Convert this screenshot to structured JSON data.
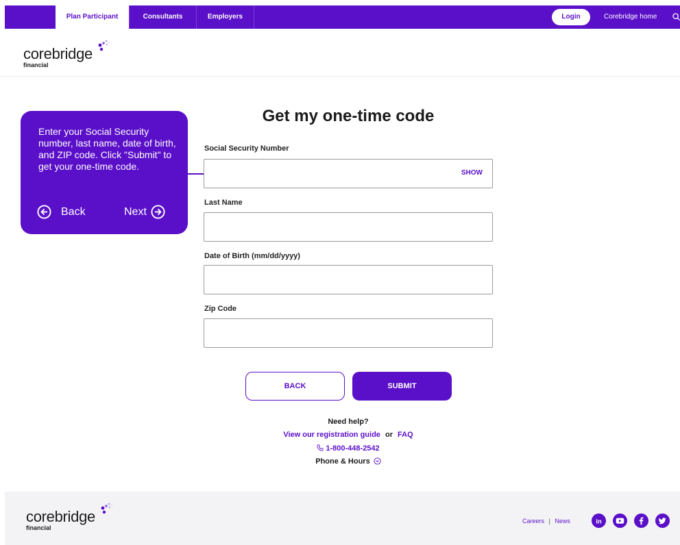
{
  "topnav": {
    "tabs": [
      "Plan Participant",
      "Consultants",
      "Employers"
    ],
    "login": "Login",
    "home": "Corebridge home",
    "search_icon": "search-icon"
  },
  "brand": {
    "word": "corebridge",
    "sub": "financial",
    "color": "#5a0fc8"
  },
  "callout": {
    "text": "Enter your Social Security number, last name, date of birth, and ZIP code. Click \"Submit\" to get your one-time code.",
    "back": "Back",
    "next": "Next"
  },
  "form": {
    "title": "Get my one-time code",
    "ssn_label": "Social Security Number",
    "ssn_value": "",
    "show": "SHOW",
    "last_name_label": "Last Name",
    "last_name_value": "",
    "dob_label": "Date of Birth (mm/dd/yyyy)",
    "dob_value": "",
    "zip_label": "Zip Code",
    "zip_value": "",
    "back_button": "BACK",
    "submit_button": "SUBMIT"
  },
  "help": {
    "heading": "Need help?",
    "guide_link": "View our registration guide",
    "or": "or",
    "faq_link": "FAQ",
    "phone": "1-800-448-2542",
    "hours": "Phone & Hours"
  },
  "footer": {
    "careers": "Careers",
    "separator": "|",
    "news": "News",
    "social": [
      "linkedin-icon",
      "youtube-icon",
      "facebook-icon",
      "twitter-icon"
    ]
  }
}
